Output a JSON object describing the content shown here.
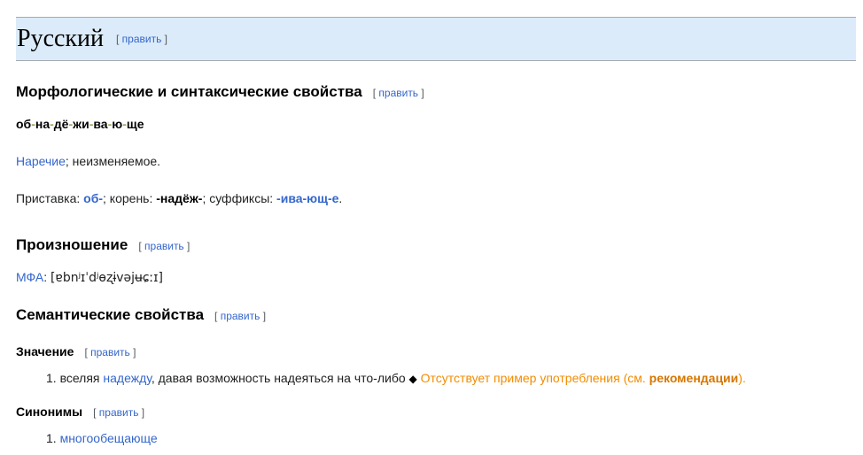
{
  "edit_label": "править",
  "language": "Русский",
  "sections": {
    "morph": {
      "title": "Морфологические и синтаксические свойства"
    },
    "pron": {
      "title": "Произношение"
    },
    "sem": {
      "title": "Семантические свойства"
    },
    "meaning": {
      "title": "Значение"
    },
    "synonyms": {
      "title": "Синонимы"
    }
  },
  "syllables": [
    "об",
    "на",
    "дё",
    "жи",
    "ва",
    "ю",
    "ще"
  ],
  "pos": {
    "link": "Наречие",
    "rest": "; неизменяемое."
  },
  "morphemes": {
    "prefix_label": "Приставка: ",
    "prefix": "об-",
    "root_label": "; корень: ",
    "root": "-надёж-",
    "suffix_label": "; суффиксы: ",
    "suffixes": "-ива-ющ-е",
    "end": "."
  },
  "ipa": {
    "label": "МФА",
    "sep": ": ",
    "value": "[ɐbnʲɪˈdʲɵʐɨvəjʉɕːɪ]"
  },
  "meaning_item": {
    "num": "1.",
    "text1": "вселяя ",
    "link": "надежду",
    "text2": ", давая возможность надеяться на что-либо ",
    "diamond": "◆",
    "missing1": " Отсутствует пример употребления (см. ",
    "missing_link": "рекомендации",
    "missing2": ")."
  },
  "synonym_item": {
    "num": "1.",
    "link": "многообещающе"
  }
}
